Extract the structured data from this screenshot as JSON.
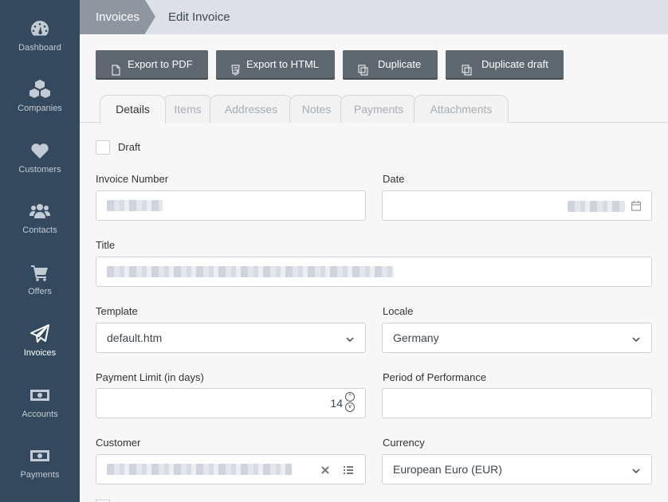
{
  "sidebar": {
    "items": [
      {
        "label": "Dashboard",
        "icon": "dashboard-icon"
      },
      {
        "label": "Companies",
        "icon": "cubes-icon"
      },
      {
        "label": "Customers",
        "icon": "heart-icon"
      },
      {
        "label": "Contacts",
        "icon": "users-icon"
      },
      {
        "label": "Offers",
        "icon": "cart-icon"
      },
      {
        "label": "Invoices",
        "icon": "paper-plane-icon"
      },
      {
        "label": "Accounts",
        "icon": "money-icon"
      },
      {
        "label": "Payments",
        "icon": "money-icon"
      }
    ],
    "active": "Invoices"
  },
  "breadcrumb": {
    "parent": "Invoices",
    "current": "Edit Invoice"
  },
  "toolbar": {
    "export_pdf": "Export to PDF",
    "export_html": "Export to HTML",
    "duplicate": "Duplicate",
    "duplicate_draft": "Duplicate draft"
  },
  "tabs": [
    "Details",
    "Items",
    "Addresses",
    "Notes",
    "Payments",
    "Attachments"
  ],
  "active_tab": "Details",
  "form": {
    "draft_label": "Draft",
    "draft_checked": false,
    "invoice_number_label": "Invoice Number",
    "date_label": "Date",
    "title_label": "Title",
    "template_label": "Template",
    "template_value": "default.htm",
    "locale_label": "Locale",
    "locale_value": "Germany",
    "payment_limit_label": "Payment Limit (in days)",
    "payment_limit_value": "14",
    "period_label": "Period of Performance",
    "period_value": "",
    "customer_label": "Customer",
    "currency_label": "Currency",
    "currency_value": "European Euro (EUR)"
  },
  "colors": {
    "sidebar_bg": "#34495e",
    "button_bg": "#5e6670",
    "breadcrumb_active": "#8f969f"
  }
}
